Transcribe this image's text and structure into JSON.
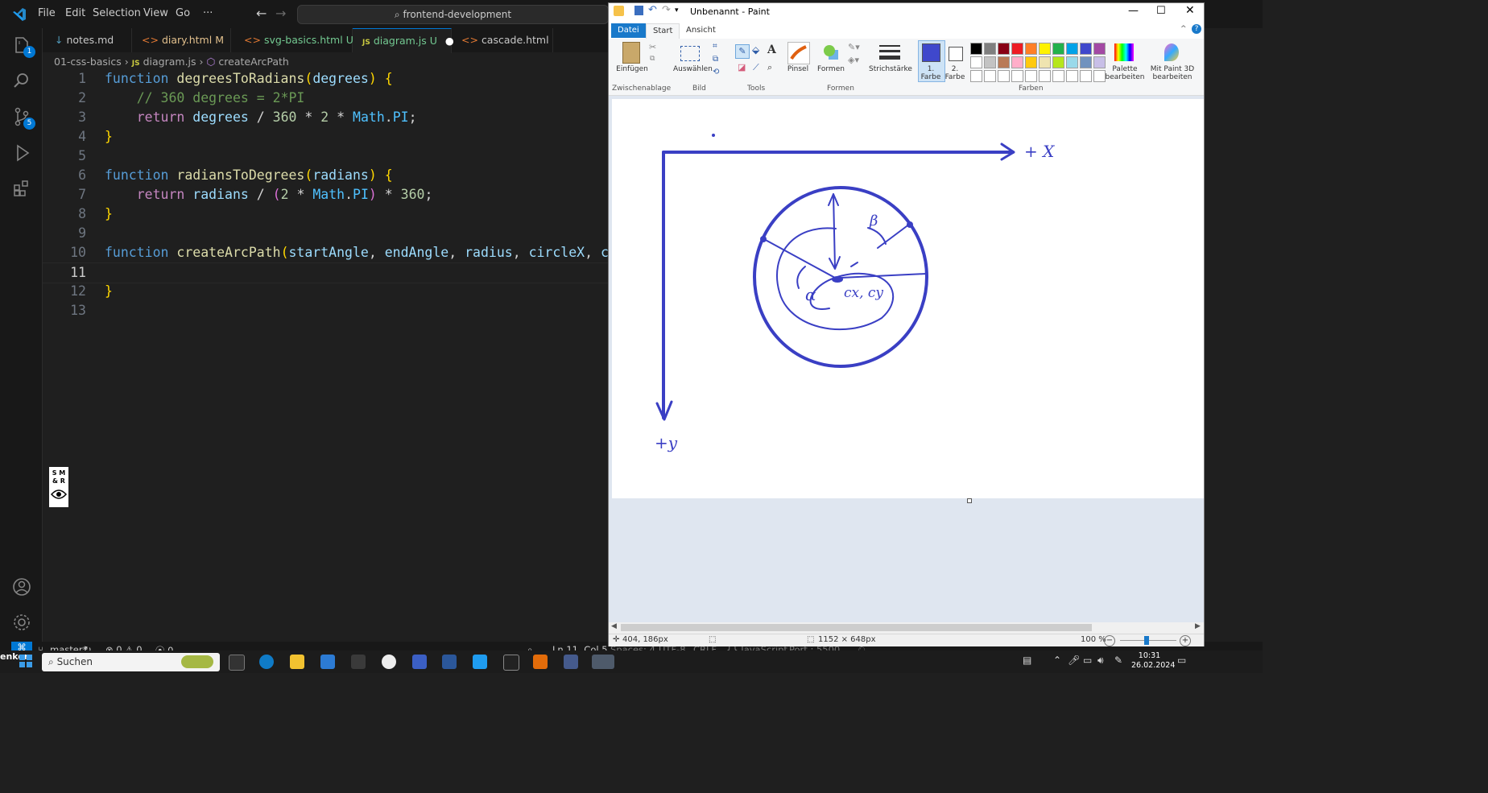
{
  "vscode": {
    "menu": [
      "File",
      "Edit",
      "Selection",
      "View",
      "Go",
      "···"
    ],
    "search": "frontend-development",
    "explorer_badge": "1",
    "scm_badge": "5",
    "tabs": [
      {
        "icon": "↓",
        "label": "notes.md",
        "status": ""
      },
      {
        "icon": "<>",
        "label": "diary.html",
        "status": "M"
      },
      {
        "icon": "<>",
        "label": "svg-basics.html",
        "status": "U"
      },
      {
        "icon": "JS",
        "label": "diagram.js",
        "status": "U"
      },
      {
        "icon": "<>",
        "label": "cascade.html",
        "status": ""
      }
    ],
    "breadcrumb": {
      "folder": "01-css-basics",
      "file": "diagram.js",
      "symbol": "createArcPath"
    },
    "line_numbers": [
      "1",
      "2",
      "3",
      "4",
      "5",
      "6",
      "7",
      "8",
      "9",
      "10",
      "11",
      "12",
      "13"
    ],
    "code": {
      "l1": [
        "function",
        " degreesToRadians",
        "(",
        "degrees",
        ")",
        " {"
      ],
      "l2": "    // 360 degrees = 2*PI",
      "l3": [
        "    return ",
        "degrees",
        " / ",
        "360",
        " * ",
        "2",
        " * ",
        "Math",
        ".",
        "PI",
        ";"
      ],
      "l4": "}",
      "l6": [
        "function",
        " radiansToDegrees",
        "(",
        "radians",
        ")",
        " {"
      ],
      "l7": [
        "    return ",
        "radians",
        " / ",
        "(",
        "2",
        " * ",
        "Math",
        ".",
        "PI",
        ")",
        " * ",
        "360",
        ";"
      ],
      "l8": "}",
      "l10": [
        "function",
        " createArcPath",
        "(",
        "startAngle",
        ", ",
        "endAngle",
        ", ",
        "radius",
        ", ",
        "circleX",
        ", ",
        "c"
      ],
      "l12": "}"
    },
    "overlay_logo": "S M & R",
    "status": {
      "branch": "master*",
      "errors": "0",
      "warnings": "0",
      "ports": "0",
      "cursor": "Ln 11, Col 5",
      "spaces": "Spaces: 4",
      "encoding": "UTF-8",
      "eol": "CRLF",
      "language": "JavaScript",
      "port": "Port : 5500",
      "left_fragment": "enker"
    }
  },
  "paint": {
    "title": "Unbenannt - Paint",
    "tabs": [
      "Datei",
      "Start",
      "Ansicht"
    ],
    "groups": [
      "Zwischenablage",
      "Bild",
      "Tools",
      "Formen",
      "Farben"
    ],
    "buttons": {
      "paste": "Einfügen",
      "select": "Auswählen",
      "brush": "Pinsel",
      "shapes": "Formen",
      "stroke": "Strichstärke",
      "color1": "1. Farbe",
      "color2": "2. Farbe",
      "edit_palette": "Palette bearbeiten",
      "paint3d": "Mit Paint 3D bearbeiten"
    },
    "colors": {
      "row1": [
        "#000000",
        "#7f7f7f",
        "#880015",
        "#ed1c24",
        "#ff7f27",
        "#fff200",
        "#22b14c",
        "#00a2e8",
        "#3f48cc",
        "#a349a4"
      ],
      "row2": [
        "#ffffff",
        "#c3c3c3",
        "#b97a57",
        "#ffaec9",
        "#ffc90e",
        "#efe4b0",
        "#b5e61d",
        "#99d9ea",
        "#7092be",
        "#c8bfe7"
      ],
      "primary": "#3f48cc",
      "drawing": "#3a3fc4"
    },
    "drawing_labels": {
      "x_axis": "+ X",
      "y_axis": "+y",
      "center": "cx, cy",
      "alpha": "α",
      "beta": "β"
    },
    "status": {
      "position": "404, 186px",
      "size": "1152 × 648px",
      "zoom": "100 %"
    }
  },
  "taskbar": {
    "search": "Suchen",
    "time": "10:31",
    "date": "26.02.2024"
  }
}
